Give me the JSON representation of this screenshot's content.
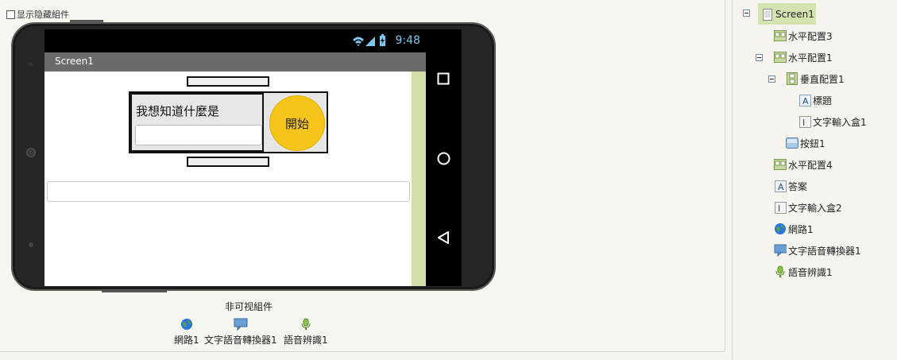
{
  "viewer": {
    "show_hidden_label": "显示隐藏組件",
    "phone": {
      "status_time": "9:48",
      "screen_title": "Screen1",
      "label_text": "我想知道什麼是",
      "start_button": "開始"
    },
    "nonvisible_title": "非可视組件",
    "nonvisible_items": [
      {
        "label": "網路1",
        "icon": "web-icon"
      },
      {
        "label": "文字語音轉換器1",
        "icon": "speech-bubble-icon"
      },
      {
        "label": "語音辨識1",
        "icon": "microphone-icon"
      }
    ]
  },
  "tree": {
    "items": [
      {
        "label": "Screen1",
        "icon": "screen-icon",
        "selected": true
      },
      {
        "label": "水平配置3",
        "icon": "horizontal-arrangement-icon"
      },
      {
        "label": "水平配置1",
        "icon": "horizontal-arrangement-icon"
      },
      {
        "label": "垂直配置1",
        "icon": "vertical-arrangement-icon"
      },
      {
        "label": "標題",
        "icon": "label-icon"
      },
      {
        "label": "文字輸入盒1",
        "icon": "textbox-icon"
      },
      {
        "label": "按鈕1",
        "icon": "button-icon"
      },
      {
        "label": "水平配置4",
        "icon": "horizontal-arrangement-icon"
      },
      {
        "label": "答案",
        "icon": "label-icon"
      },
      {
        "label": "文字輸入盒2",
        "icon": "textbox-icon"
      },
      {
        "label": "網路1",
        "icon": "web-icon"
      },
      {
        "label": "文字語音轉換器1",
        "icon": "speech-bubble-icon"
      },
      {
        "label": "語音辨識1",
        "icon": "microphone-icon"
      }
    ]
  },
  "colors": {
    "accent_button": "#f7c51a",
    "selection": "#d5e3b0",
    "status_text": "#7ec8f0"
  }
}
